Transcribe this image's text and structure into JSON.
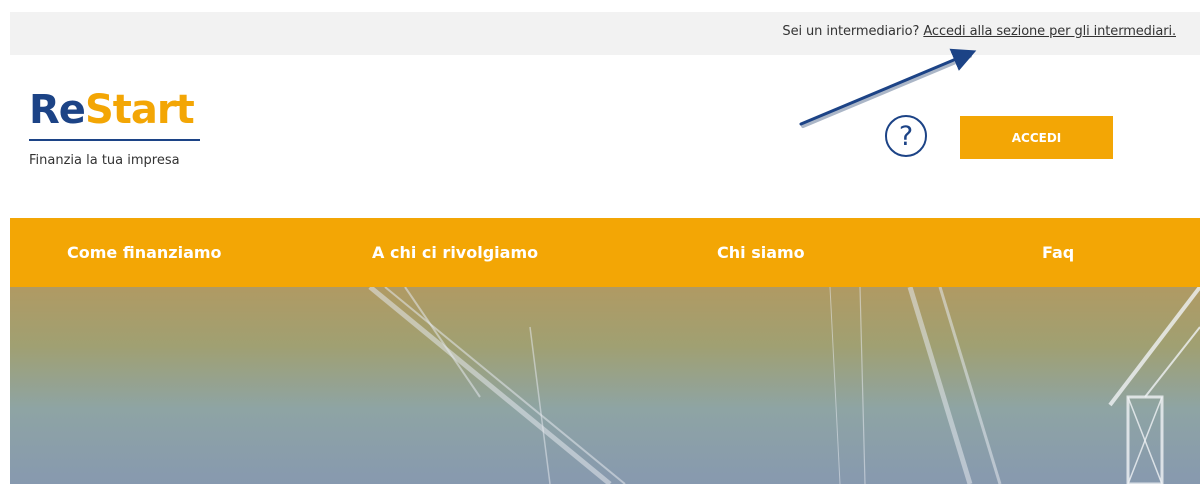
{
  "topbar": {
    "question": "Sei un intermediario?",
    "link": "Accedi alla sezione per gli intermediari."
  },
  "brand": {
    "name_part1": "Re",
    "name_part2": "Start",
    "tagline": "Finanzia la tua impresa",
    "primary_color": "#1c4386",
    "accent_color": "#f3a605"
  },
  "header": {
    "help_icon": "?",
    "login_label": "ACCEDI"
  },
  "nav": {
    "items": [
      {
        "label": "Come finanziamo"
      },
      {
        "label": "A chi ci rivolgiamo"
      },
      {
        "label": "Chi siamo"
      },
      {
        "label": "Faq"
      }
    ]
  },
  "annotation": {
    "icon": "arrow-annotation-icon",
    "color": "#1c4386"
  },
  "hero": {
    "image": "construction-cranes-photo"
  }
}
